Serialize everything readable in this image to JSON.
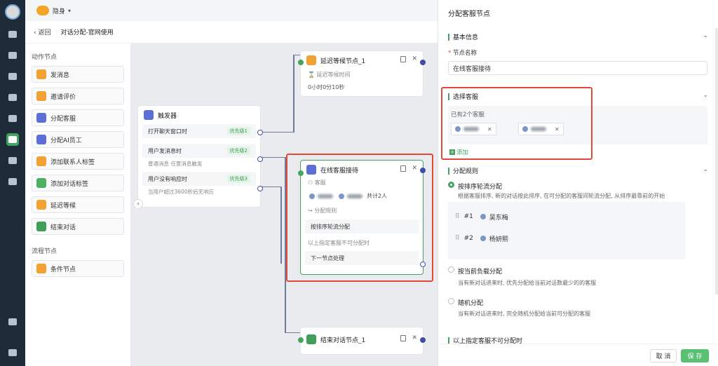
{
  "app": {
    "account_name": "隐身"
  },
  "subheader": {
    "back_label": "返回",
    "flow_title": "对话分配-官网使用"
  },
  "palette": {
    "action_section": "动作节点",
    "actions": [
      "发消息",
      "邀请评价",
      "分配客服",
      "分配AI员工",
      "添加联系人标签",
      "添加对话标签",
      "延迟等候",
      "结束对话"
    ],
    "flow_section": "流程节点",
    "flows": [
      "条件节点"
    ]
  },
  "canvas": {
    "delay_node": {
      "title": "延迟等候节点_1",
      "field_label": "延迟等候时间",
      "value": "0小时0分10秒"
    },
    "trigger_node": {
      "title": "触发器",
      "rows": [
        {
          "label": "打开聊天窗口时",
          "priority": "优先级1",
          "sub": ""
        },
        {
          "label": "用户发消息时",
          "priority": "优先级2",
          "sub": "普通消息 任意消息触发"
        },
        {
          "label": "用户没有响应时",
          "priority": "优先级3",
          "sub": "当用户超过3600秒后无响应"
        }
      ]
    },
    "assign_node": {
      "title": "在线客服接待",
      "agents_label": "客服",
      "agents_summary": "共计2人",
      "rule_label": "分配规则",
      "rule_value": "按排序轮流分配",
      "unavailable_label": "以上指定客服不可分配时",
      "next_label": "下一节点处理"
    },
    "end_node": {
      "title": "结束对话节点_1"
    }
  },
  "panel": {
    "title": "分配客服节点",
    "basic_section": "基本信息",
    "name_label": "节点名称",
    "name_required": "*",
    "name_value": "在线客服接待",
    "agent_section": "选择客服",
    "agent_count": "已有2个客服",
    "add_label": "添加",
    "rule_section": "分配规则",
    "options": [
      {
        "label": "按排序轮流分配",
        "desc": "根据客服排序, 新的对话按此排序, 在可分配的客服间轮流分配, 从排序最靠前的开始",
        "selected": true
      },
      {
        "label": "按当前负载分配",
        "desc": "当有新对话进来时, 优先分配给当前对话数最少的的客服",
        "selected": false
      },
      {
        "label": "随机分配",
        "desc": "当有新对话进来时, 完全随机分配给当前可分配的客服",
        "selected": false
      }
    ],
    "ranking": [
      {
        "rank": "#1",
        "name": "吴东梅"
      },
      {
        "rank": "#2",
        "name": "杨妍熙"
      }
    ],
    "unavailable_section": "以上指定客服不可分配时",
    "cancel_label": "取 消",
    "save_label": "保 存"
  },
  "colors": {
    "accent": "#41a561",
    "highlight": "#e04a3a",
    "sidebar": "#1e2c3a"
  }
}
